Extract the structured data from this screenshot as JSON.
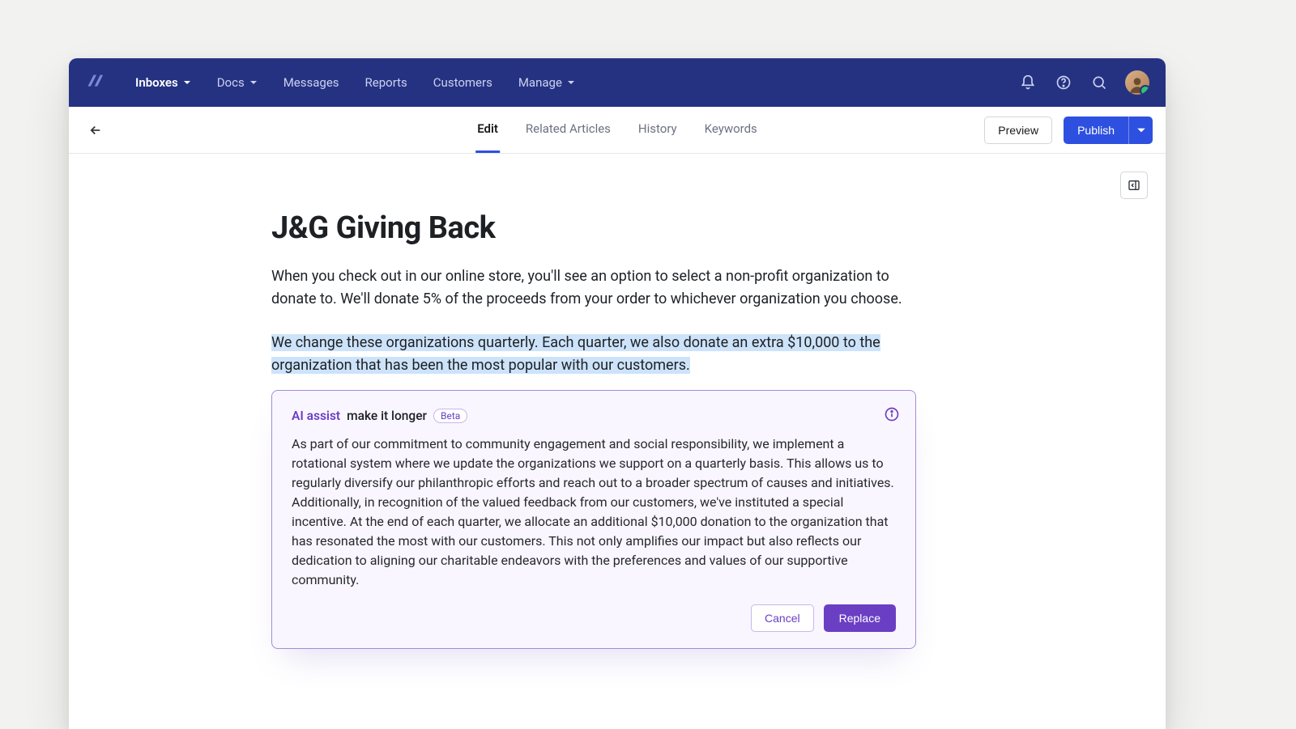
{
  "nav": {
    "items": [
      {
        "label": "Inboxes",
        "dropdown": true,
        "active": true
      },
      {
        "label": "Docs",
        "dropdown": true,
        "active": false
      },
      {
        "label": "Messages",
        "dropdown": false,
        "active": false
      },
      {
        "label": "Reports",
        "dropdown": false,
        "active": false
      },
      {
        "label": "Customers",
        "dropdown": false,
        "active": false
      },
      {
        "label": "Manage",
        "dropdown": true,
        "active": false
      }
    ]
  },
  "subbar": {
    "tabs": [
      {
        "label": "Edit",
        "active": true
      },
      {
        "label": "Related Articles",
        "active": false
      },
      {
        "label": "History",
        "active": false
      },
      {
        "label": "Keywords",
        "active": false
      }
    ],
    "preview_label": "Preview",
    "publish_label": "Publish"
  },
  "document": {
    "title": "J&G Giving Back",
    "paragraph1": "When you check out in our online store, you'll see an option to select a non-profit organization to donate to. We'll donate 5% of the proceeds from your order to whichever organization you choose.",
    "highlighted": "We change these organizations quarterly. Each quarter, we also donate an extra $10,000 to the organization that has been the most popular with our customers."
  },
  "ai": {
    "label": "AI assist",
    "prompt": "make it longer",
    "badge": "Beta",
    "body": "As part of our commitment to community engagement and social responsibility, we implement a rotational system where we update the organizations we support on a quarterly basis. This allows us to regularly diversify our philanthropic efforts and reach out to a broader spectrum of causes and initiatives. Additionally, in recognition of the valued feedback from our customers, we've instituted a special incentive. At the end of each quarter, we allocate an additional $10,000 donation to the organization that has resonated the most with our customers. This not only amplifies our impact but also reflects our dedication to aligning our charitable endeavors with the preferences and values of our supportive community.",
    "cancel_label": "Cancel",
    "replace_label": "Replace"
  }
}
